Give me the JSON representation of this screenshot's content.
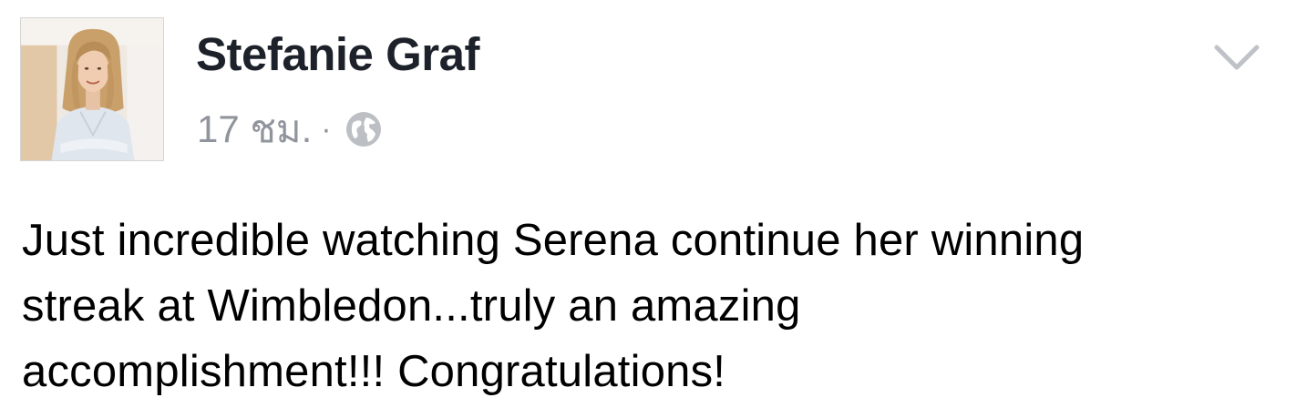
{
  "post": {
    "author": "Stefanie Graf",
    "timestamp": "17 ชม.",
    "separator": "·",
    "privacy_icon": "globe-icon",
    "menu_icon": "chevron-down-icon",
    "text_lines": [
      "Just incredible watching Serena continue her winning",
      "streak at Wimbledon...truly an amazing",
      "accomplishment!!! Congratulations!"
    ]
  },
  "colors": {
    "name": "#1d2129",
    "meta": "#90949c",
    "text": "#000000",
    "chevron": "#bfc2c7"
  }
}
